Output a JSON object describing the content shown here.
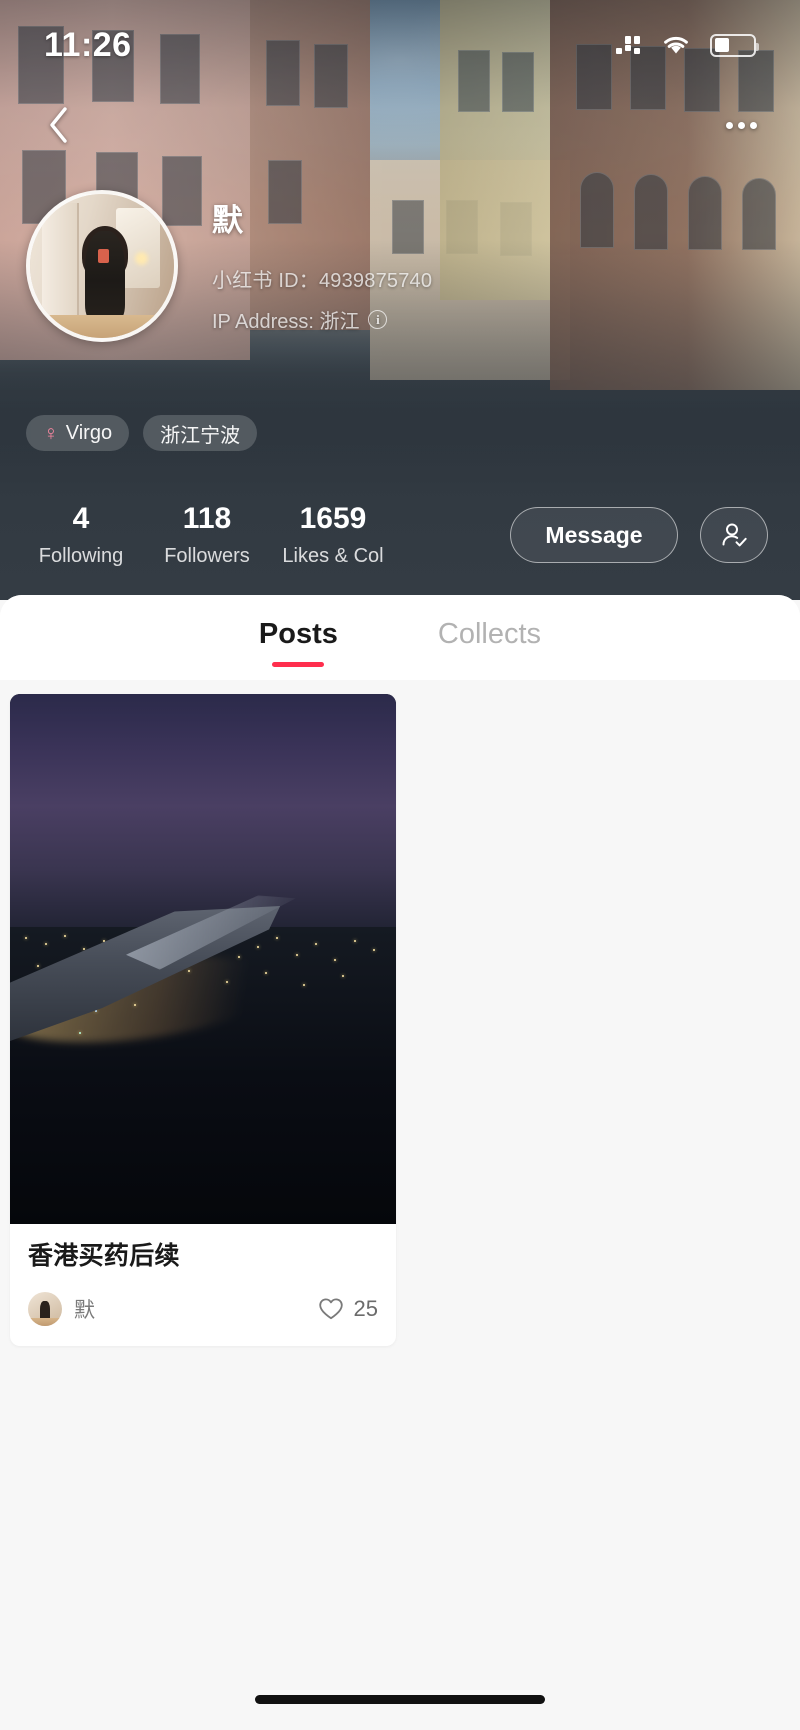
{
  "status_bar": {
    "time": "11:26",
    "signal_icon": "signal-dots-icon",
    "wifi_icon": "wifi-icon",
    "battery_icon": "battery-icon"
  },
  "nav": {
    "back_icon": "back-chevron-icon",
    "more_icon": "more-dots-icon"
  },
  "profile": {
    "avatar_name": "user-avatar",
    "username": "默",
    "user_id_label": "小红书 ID：4939875740",
    "ip_label": "IP Address: 浙江",
    "info_icon_glyph": "i",
    "tags": [
      {
        "icon": "venus-female-icon",
        "glyph": "♀",
        "label": "Virgo"
      },
      {
        "icon": null,
        "glyph": "",
        "label": "浙江宁波"
      }
    ]
  },
  "stats": [
    {
      "value": "4",
      "label": "Following"
    },
    {
      "value": "118",
      "label": "Followers"
    },
    {
      "value": "1659",
      "label": "Likes & Col"
    }
  ],
  "actions": {
    "message_label": "Message",
    "follow_icon": "person-check-icon"
  },
  "tabs": [
    {
      "label": "Posts",
      "active": true
    },
    {
      "label": "Collects",
      "active": false
    }
  ],
  "posts": [
    {
      "image_name": "airplane-wing-night-city-photo",
      "title": "香港买药后续",
      "author": "默",
      "likes": "25",
      "like_icon": "heart-outline-icon"
    }
  ],
  "colors": {
    "accent_red": "#ff2e4d",
    "hero_dark": "#343c44",
    "feed_bg": "#f7f7f7",
    "venus_pink": "#f5869f"
  }
}
